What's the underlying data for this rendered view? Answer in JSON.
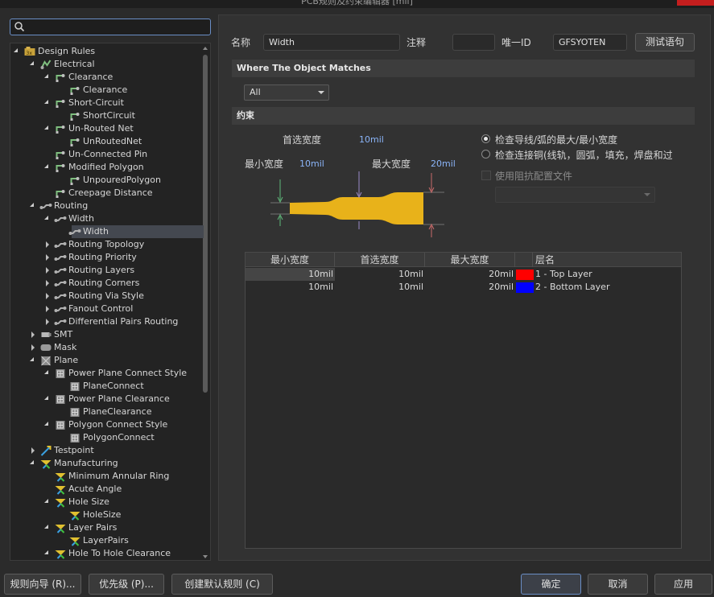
{
  "window": {
    "title": "PCB规则及约束编辑器 [mil]"
  },
  "search": {
    "placeholder": ""
  },
  "tree": [
    {
      "label": "Design Rules",
      "level": 0,
      "toggle": "open",
      "icon": "design-rules-icon"
    },
    {
      "label": "Electrical",
      "level": 1,
      "toggle": "open",
      "icon": "electrical-icon"
    },
    {
      "label": "Clearance",
      "level": 2,
      "toggle": "open",
      "icon": "rule-category-icon"
    },
    {
      "label": "Clearance",
      "level": 3,
      "toggle": "none",
      "icon": "rule-icon"
    },
    {
      "label": "Short-Circuit",
      "level": 2,
      "toggle": "open",
      "icon": "rule-category-icon"
    },
    {
      "label": "ShortCircuit",
      "level": 3,
      "toggle": "none",
      "icon": "rule-icon"
    },
    {
      "label": "Un-Routed Net",
      "level": 2,
      "toggle": "open",
      "icon": "rule-category-icon"
    },
    {
      "label": "UnRoutedNet",
      "level": 3,
      "toggle": "none",
      "icon": "rule-icon"
    },
    {
      "label": "Un-Connected Pin",
      "level": 2,
      "toggle": "none",
      "icon": "rule-category-icon"
    },
    {
      "label": "Modified Polygon",
      "level": 2,
      "toggle": "open",
      "icon": "rule-category-icon"
    },
    {
      "label": "UnpouredPolygon",
      "level": 3,
      "toggle": "none",
      "icon": "rule-icon"
    },
    {
      "label": "Creepage Distance",
      "level": 2,
      "toggle": "none",
      "icon": "rule-category-icon"
    },
    {
      "label": "Routing",
      "level": 1,
      "toggle": "open",
      "icon": "routing-icon"
    },
    {
      "label": "Width",
      "level": 2,
      "toggle": "open",
      "icon": "routing-rule-icon"
    },
    {
      "label": "Width",
      "level": 3,
      "toggle": "none",
      "icon": "routing-rule-icon",
      "selected": true
    },
    {
      "label": "Routing Topology",
      "level": 2,
      "toggle": "closed",
      "icon": "routing-rule-icon"
    },
    {
      "label": "Routing Priority",
      "level": 2,
      "toggle": "closed",
      "icon": "routing-rule-icon"
    },
    {
      "label": "Routing Layers",
      "level": 2,
      "toggle": "closed",
      "icon": "routing-rule-icon"
    },
    {
      "label": "Routing Corners",
      "level": 2,
      "toggle": "closed",
      "icon": "routing-rule-icon"
    },
    {
      "label": "Routing Via Style",
      "level": 2,
      "toggle": "closed",
      "icon": "routing-rule-icon"
    },
    {
      "label": "Fanout Control",
      "level": 2,
      "toggle": "closed",
      "icon": "routing-rule-icon"
    },
    {
      "label": "Differential Pairs Routing",
      "level": 2,
      "toggle": "closed",
      "icon": "routing-rule-icon"
    },
    {
      "label": "SMT",
      "level": 1,
      "toggle": "closed",
      "icon": "smt-icon"
    },
    {
      "label": "Mask",
      "level": 1,
      "toggle": "closed",
      "icon": "mask-icon"
    },
    {
      "label": "Plane",
      "level": 1,
      "toggle": "open",
      "icon": "plane-icon"
    },
    {
      "label": "Power Plane Connect Style",
      "level": 2,
      "toggle": "open",
      "icon": "plane-rule-icon"
    },
    {
      "label": "PlaneConnect",
      "level": 3,
      "toggle": "none",
      "icon": "plane-rule-icon"
    },
    {
      "label": "Power Plane Clearance",
      "level": 2,
      "toggle": "open",
      "icon": "plane-rule-icon"
    },
    {
      "label": "PlaneClearance",
      "level": 3,
      "toggle": "none",
      "icon": "plane-rule-icon"
    },
    {
      "label": "Polygon Connect Style",
      "level": 2,
      "toggle": "open",
      "icon": "plane-rule-icon"
    },
    {
      "label": "PolygonConnect",
      "level": 3,
      "toggle": "none",
      "icon": "plane-rule-icon"
    },
    {
      "label": "Testpoint",
      "level": 1,
      "toggle": "closed",
      "icon": "testpoint-icon"
    },
    {
      "label": "Manufacturing",
      "level": 1,
      "toggle": "open",
      "icon": "manufacturing-icon"
    },
    {
      "label": "Minimum Annular Ring",
      "level": 2,
      "toggle": "none",
      "icon": "manufacturing-rule-icon"
    },
    {
      "label": "Acute Angle",
      "level": 2,
      "toggle": "none",
      "icon": "manufacturing-rule-icon"
    },
    {
      "label": "Hole Size",
      "level": 2,
      "toggle": "open",
      "icon": "manufacturing-rule-icon"
    },
    {
      "label": "HoleSize",
      "level": 3,
      "toggle": "none",
      "icon": "manufacturing-rule-icon"
    },
    {
      "label": "Layer Pairs",
      "level": 2,
      "toggle": "open",
      "icon": "manufacturing-rule-icon"
    },
    {
      "label": "LayerPairs",
      "level": 3,
      "toggle": "none",
      "icon": "manufacturing-rule-icon"
    },
    {
      "label": "Hole To Hole Clearance",
      "level": 2,
      "toggle": "open",
      "icon": "manufacturing-rule-icon"
    }
  ],
  "header": {
    "name_label": "名称",
    "name_value": "Width",
    "comment_label": "注释",
    "comment_value": "",
    "uid_label": "唯一ID",
    "uid_value": "GFSYOTEN",
    "test_button": "测试语句"
  },
  "where": {
    "title": "Where The Object Matches",
    "scope_value": "All"
  },
  "constraints": {
    "title": "约束",
    "preferred_label": "首选宽度",
    "preferred_value": "10mil",
    "min_label": "最小宽度",
    "min_value": "10mil",
    "max_label": "最大宽度",
    "max_value": "20mil",
    "radio_1": "检查导线/弧的最大/最小宽度",
    "radio_2": "检查连接铜(线轨，圆弧，填充，焊盘和过",
    "radio_selected": 1,
    "impedance_checkbox": "使用阻抗配置文件",
    "impedance_dropdown": ""
  },
  "table": {
    "headers": [
      "最小宽度",
      "首选宽度",
      "最大宽度",
      "层名"
    ],
    "rows": [
      {
        "min": "10mil",
        "pref": "10mil",
        "max": "20mil",
        "layer": "1 - Top Layer",
        "color": "#ff0000"
      },
      {
        "min": "10mil",
        "pref": "10mil",
        "max": "20mil",
        "layer": "2 - Bottom Layer",
        "color": "#0000ff"
      }
    ]
  },
  "footer": {
    "wizard": "规则向导 (R)...",
    "priority": "优先级 (P)...",
    "create_default": "创建默认规则 (C)",
    "ok": "确定",
    "cancel": "取消",
    "apply": "应用"
  },
  "colors": {
    "trace": "#e8b21a",
    "dim_green": "#5fb87a",
    "dim_purple": "#9a8ac8",
    "dim_red": "#c86a6a"
  }
}
